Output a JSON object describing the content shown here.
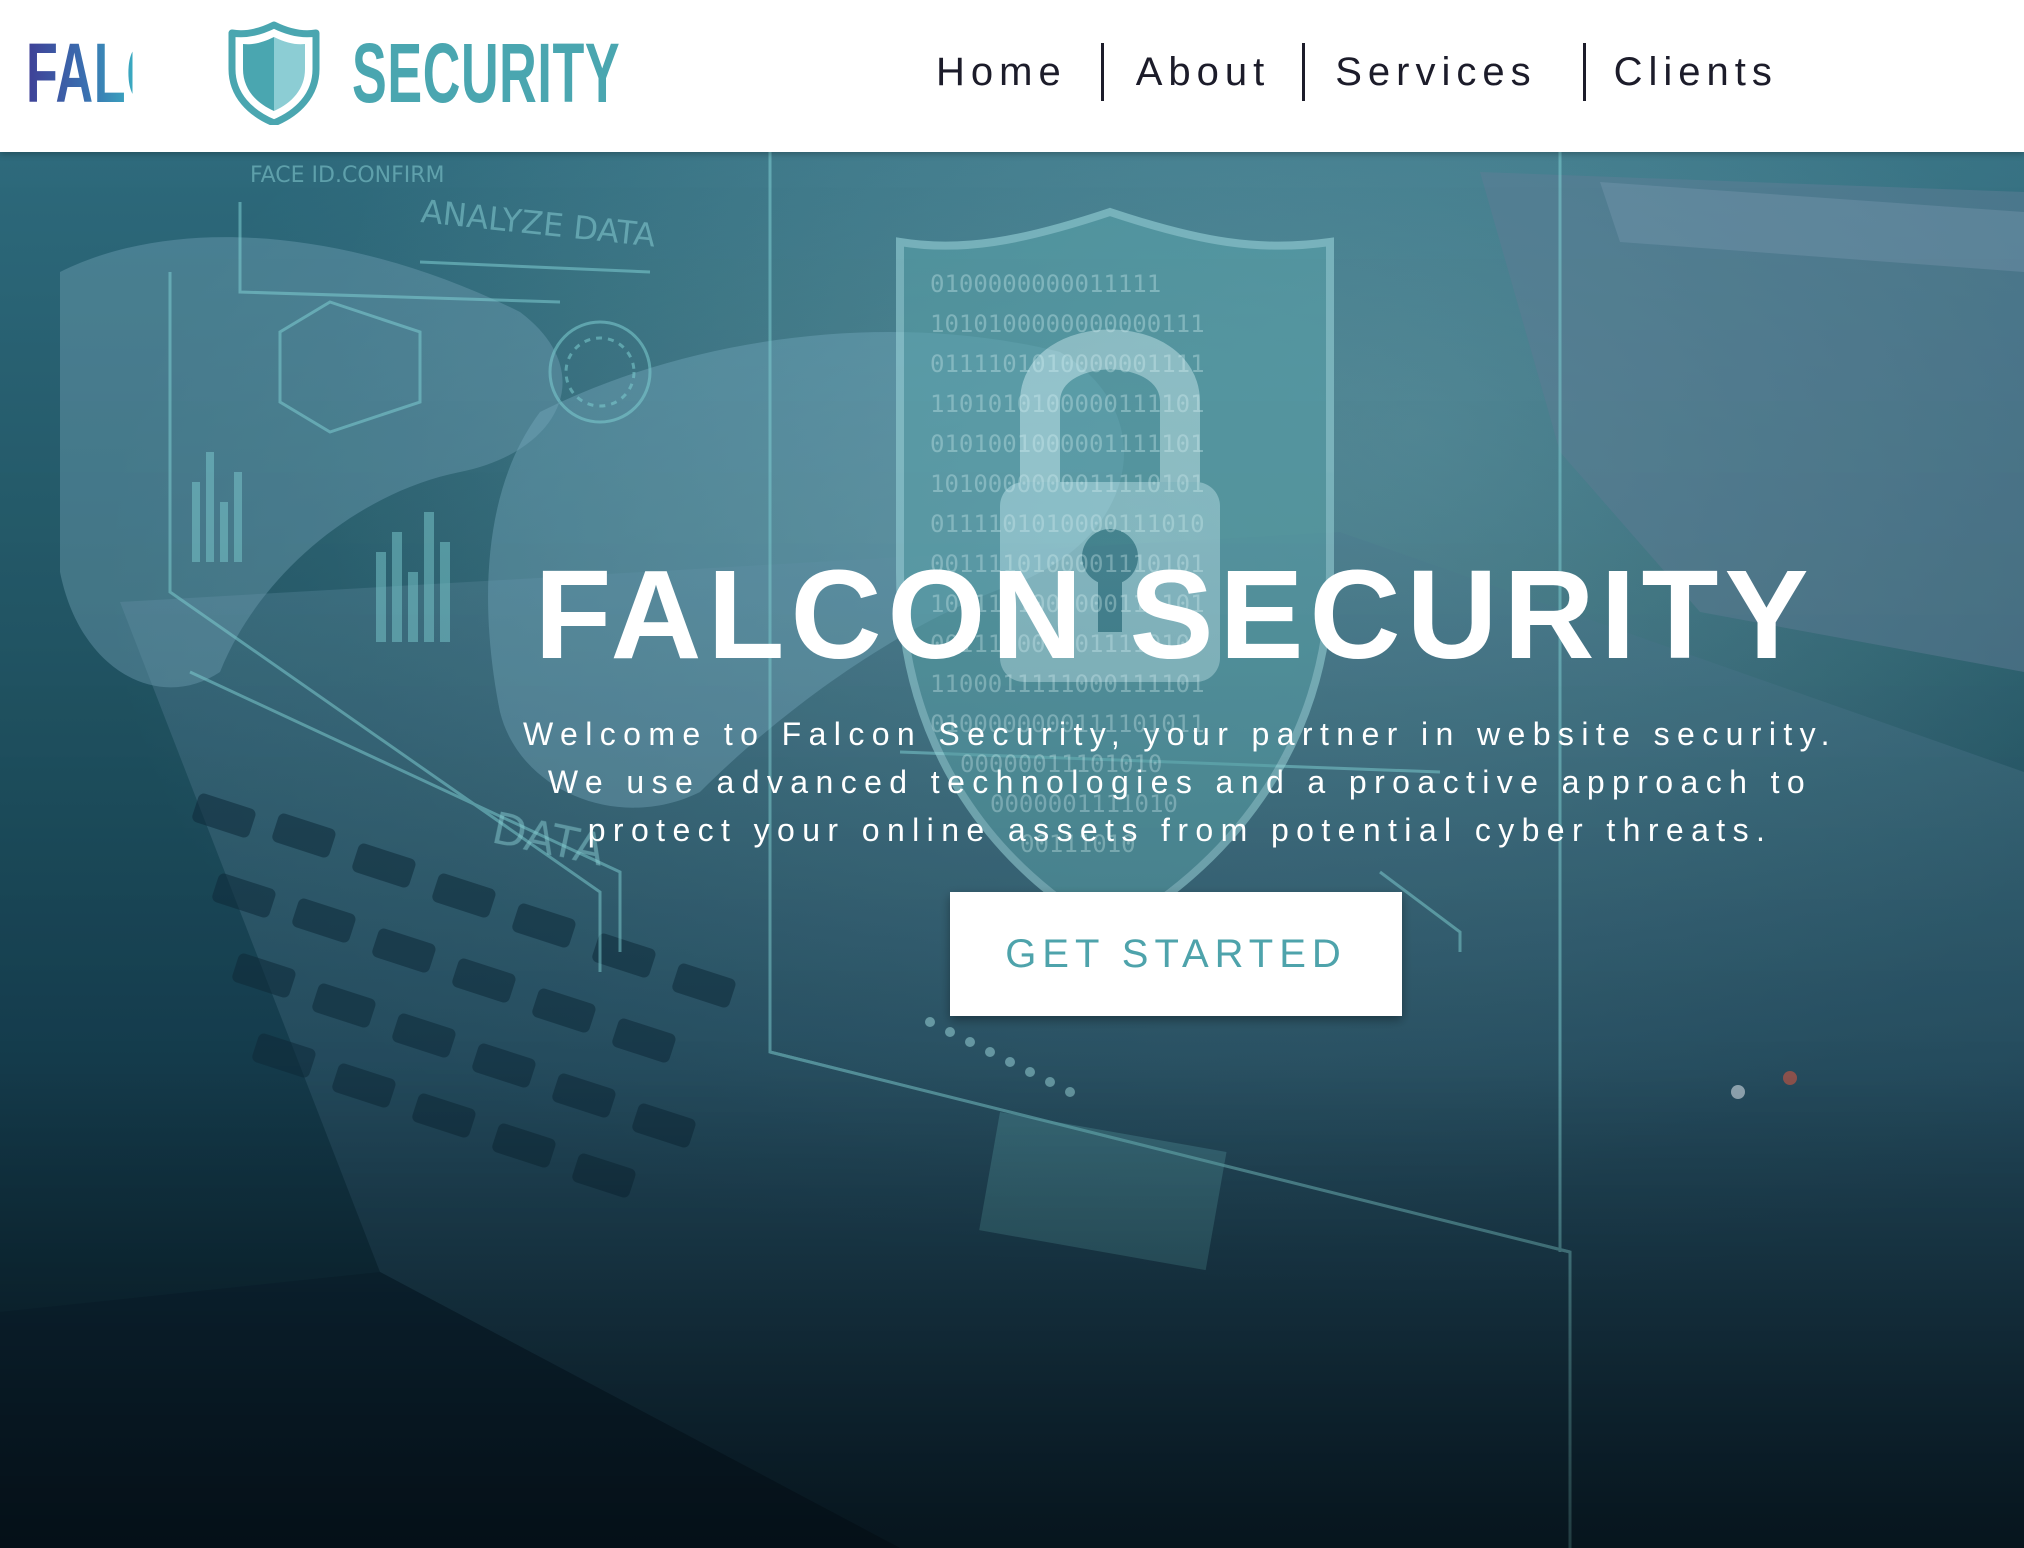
{
  "brand": {
    "name_part1": "FALCON",
    "name_part2": "SECURITY",
    "logo_icon": "shield-icon",
    "colors": {
      "falcon_gradient_start": "#3f3f96",
      "falcon_gradient_end": "#3aa9c0",
      "security": "#4aa6b0",
      "shield": "#4aa6b0"
    }
  },
  "nav": {
    "items": [
      {
        "label": "Home"
      },
      {
        "label": "About"
      },
      {
        "label": "Services"
      },
      {
        "label": "Clients"
      }
    ]
  },
  "hero": {
    "title": "FALCON SECURITY",
    "description_lines": [
      "Welcome to Falcon Security, your partner in website security.",
      "We use advanced technologies and a proactive approach to",
      "protect your online assets from potential cyber threats."
    ],
    "cta_label": "GET STARTED",
    "background_image": "cybersecurity laptop with padlock shield overlay",
    "colors": {
      "overlay": "#225766",
      "cta_text": "#4ea3ab"
    }
  }
}
